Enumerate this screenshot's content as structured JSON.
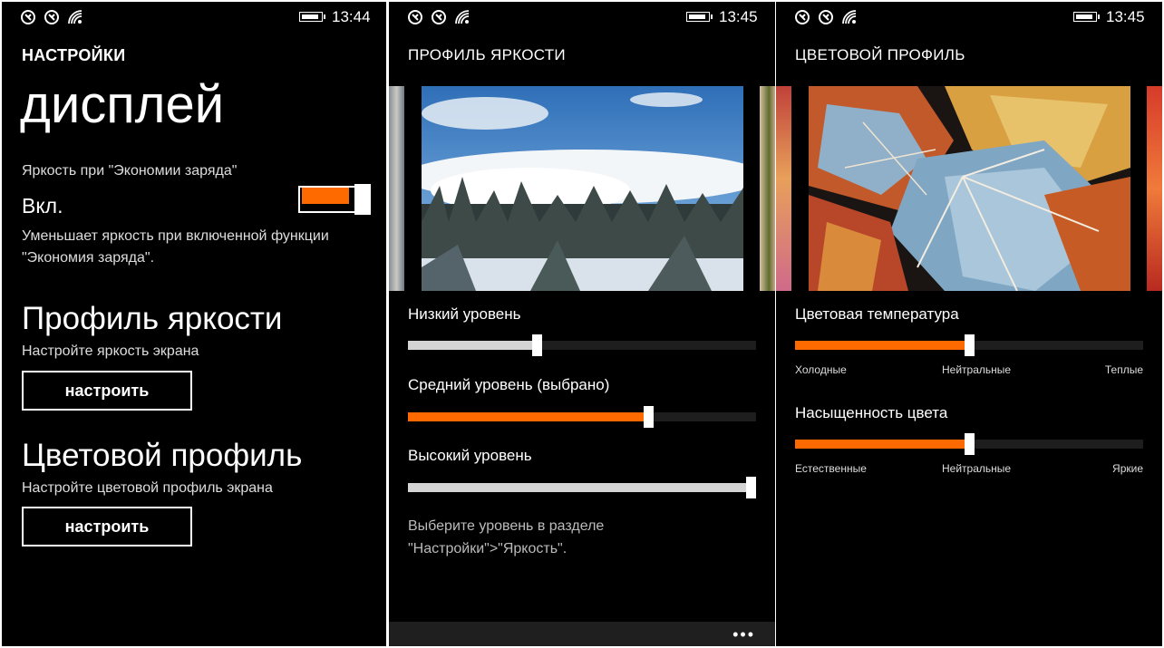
{
  "colors": {
    "accent": "#ff6a00",
    "background": "#000000",
    "text": "#ffffff",
    "track": "#1e1e1e"
  },
  "icons": [
    "nfc-icon",
    "nfc-icon",
    "wifi-icon",
    "battery-icon",
    "more-dots-icon"
  ],
  "screen1": {
    "status_time": "13:44",
    "header": "НАСТРОЙКИ",
    "title": "дисплей",
    "battery_saver_label": "Яркость при \"Экономии заряда\"",
    "battery_saver_value": "Вкл.",
    "battery_saver_on": true,
    "description_line1": "Уменьшает яркость при включенной функции",
    "description_line2": "\"Экономия заряда\".",
    "brightness_heading": "Профиль яркости",
    "brightness_sub": "Настройте яркость экрана",
    "brightness_button": "настроить",
    "color_heading": "Цветовой профиль",
    "color_sub": "Настройте цветовой профиль экрана",
    "color_button": "настроить"
  },
  "screen2": {
    "status_time": "13:45",
    "header": "ПРОФИЛЬ ЯРКОСТИ",
    "sliders": [
      {
        "label": "Низкий уровень",
        "value": 0.37
      },
      {
        "label": "Средний уровень (выбрано)",
        "value": 0.69,
        "selected": true
      },
      {
        "label": "Высокий уровень",
        "value": 1.0
      }
    ],
    "hint_line1": "Выберите уровень в разделе",
    "hint_line2": "\"Настройки\">\"Яркость\".",
    "more_dots": "•••"
  },
  "screen3": {
    "status_time": "13:45",
    "header": "ЦВЕТОВОЙ ПРОФИЛЬ",
    "temperature": {
      "label": "Цветовая температура",
      "value": 0.5,
      "min_label": "Холодные",
      "mid_label": "Нейтральные",
      "max_label": "Теплые"
    },
    "saturation": {
      "label": "Насыщенность цвета",
      "value": 0.5,
      "min_label": "Естественные",
      "mid_label": "Нейтральные",
      "max_label": "Яркие"
    }
  }
}
